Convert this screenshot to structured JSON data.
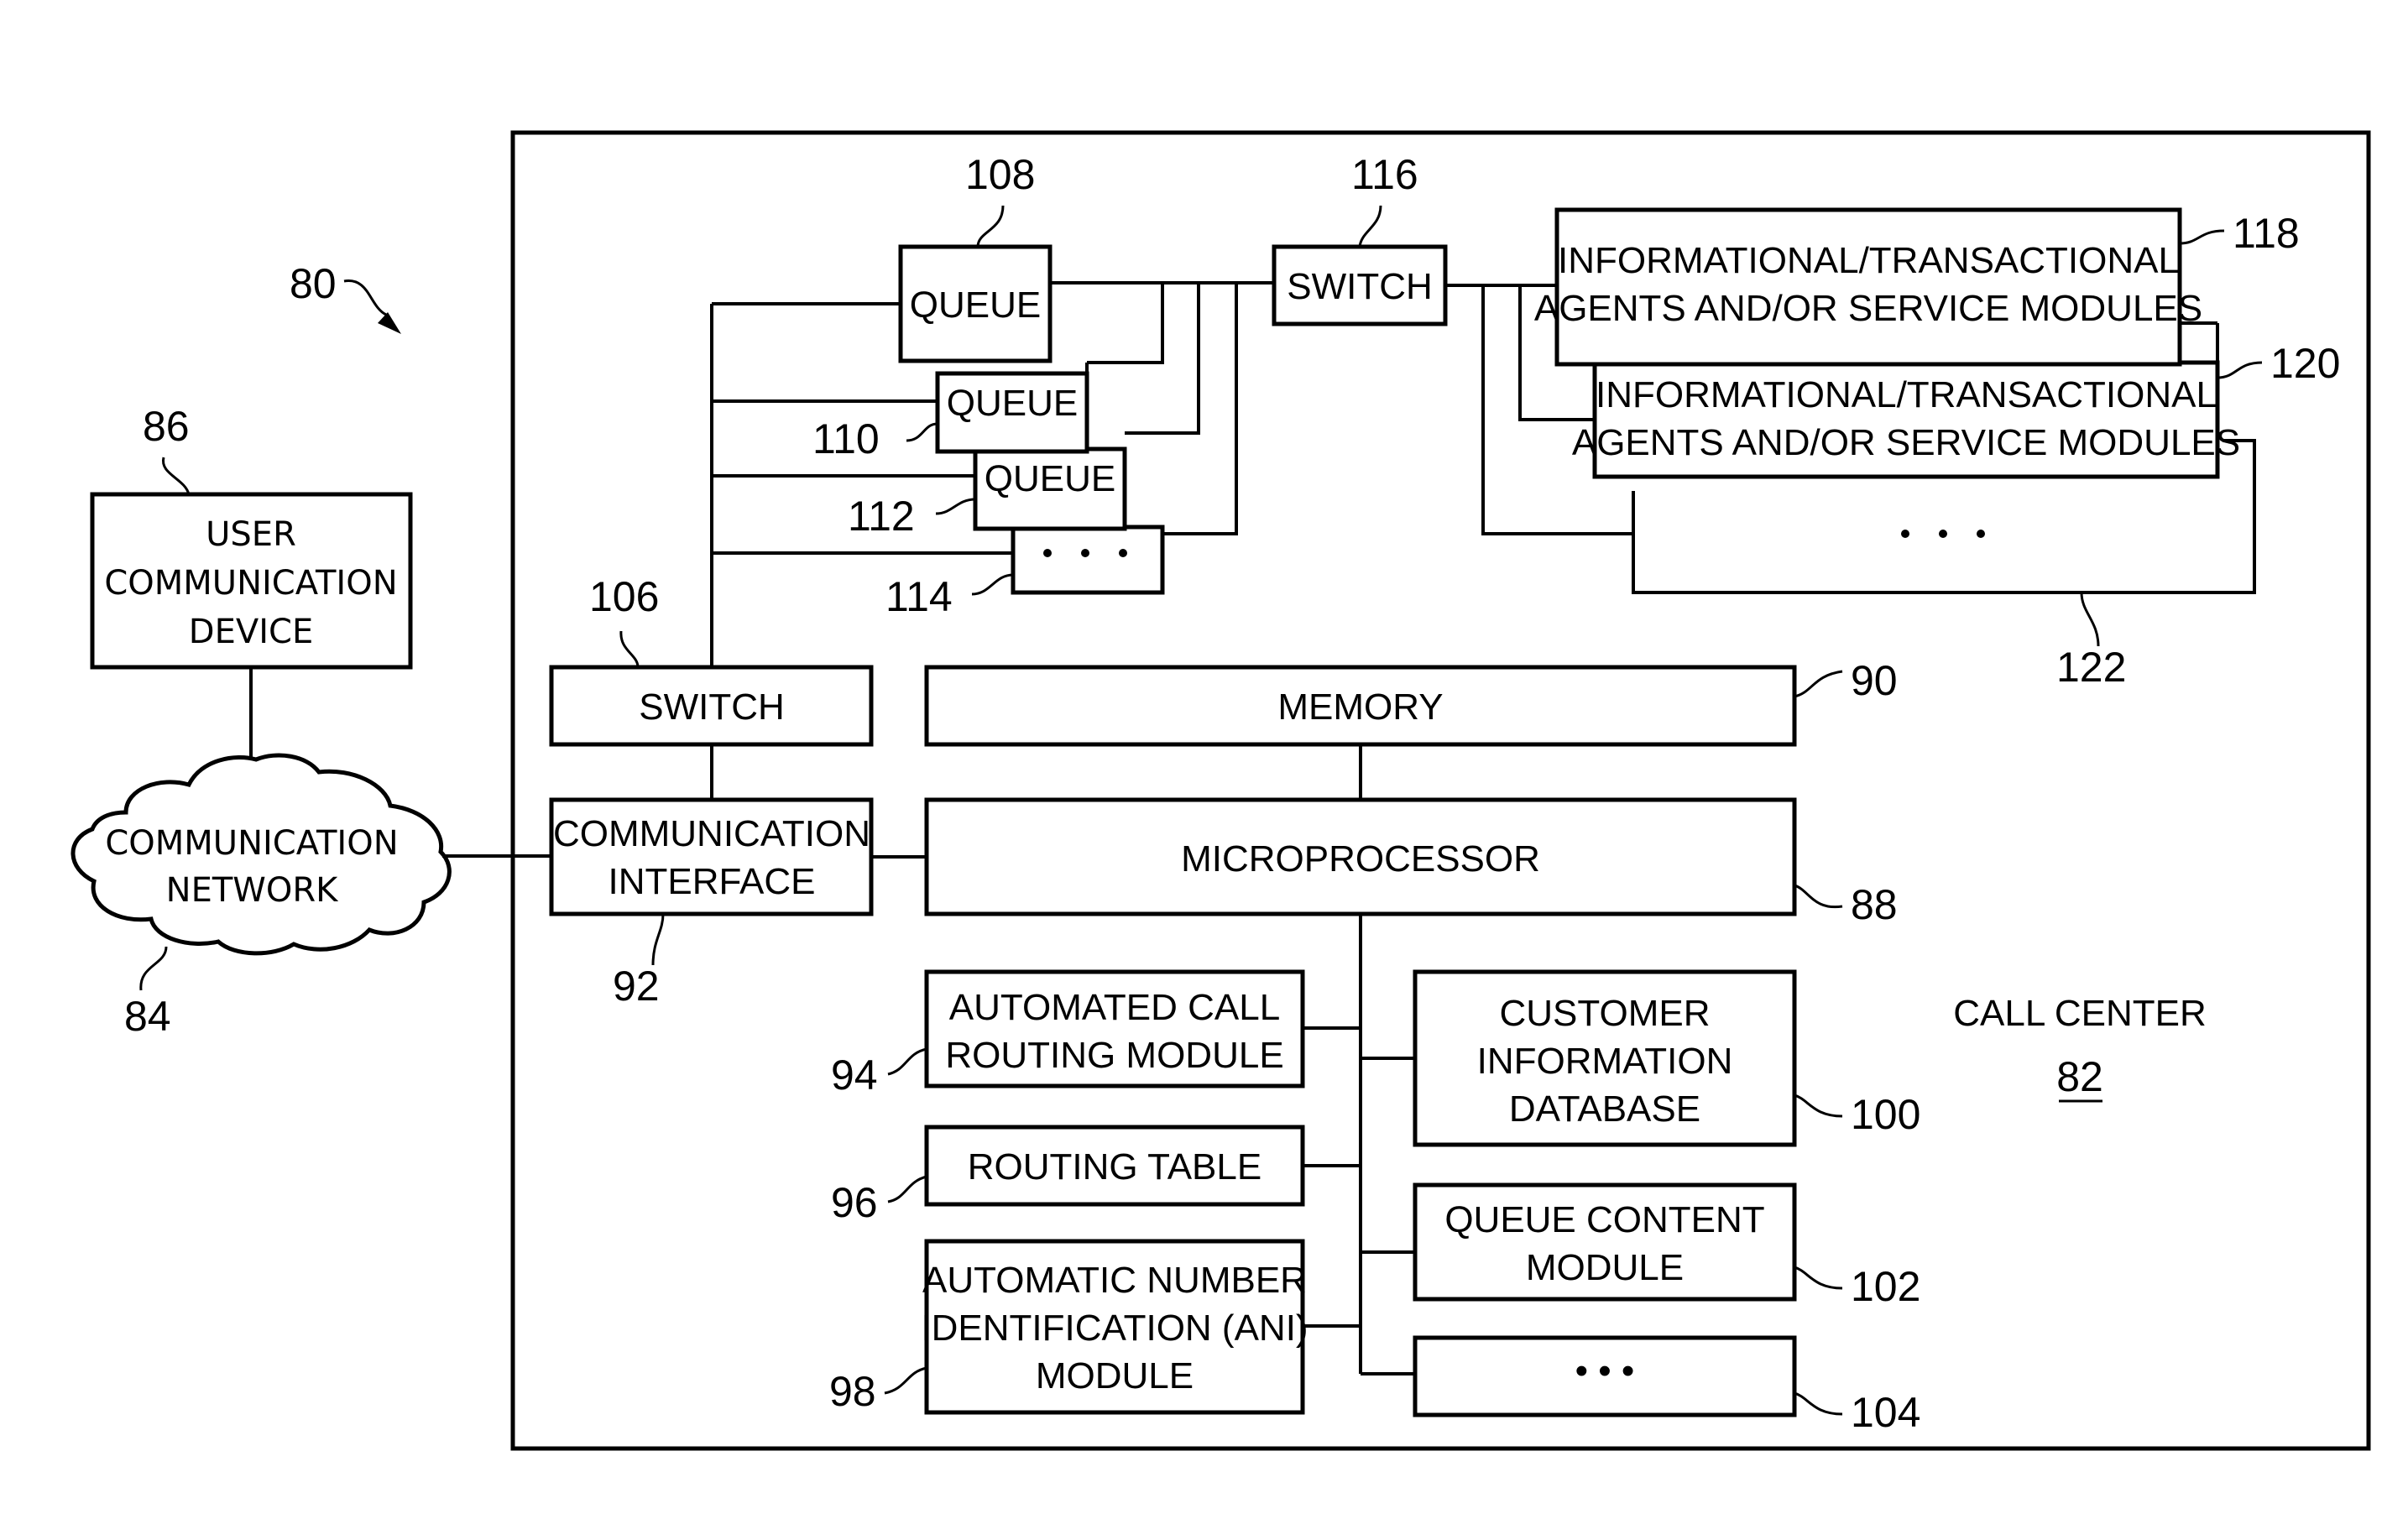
{
  "figure": {
    "figure_ref": "80",
    "call_center": {
      "label": "CALL CENTER",
      "ref": "82"
    }
  },
  "external": {
    "user_device": {
      "lines": [
        "USER",
        "COMMUNICATION",
        "DEVICE"
      ],
      "ref": "86"
    },
    "network": {
      "lines": [
        "COMMUNICATION",
        "NETWORK"
      ],
      "ref": "84"
    }
  },
  "blocks": {
    "switch_in": {
      "label": "SWITCH",
      "ref": "106"
    },
    "comm_interface": {
      "lines": [
        "COMMUNICATION",
        "INTERFACE"
      ],
      "ref": "92"
    },
    "memory": {
      "label": "MEMORY",
      "ref": "90"
    },
    "microprocessor": {
      "label": "MICROPROCESSOR",
      "ref": "88"
    },
    "auto_call_routing": {
      "lines": [
        "AUTOMATED CALL",
        "ROUTING MODULE"
      ],
      "ref": "94"
    },
    "routing_table": {
      "label": "ROUTING TABLE",
      "ref": "96"
    },
    "ani_module": {
      "lines": [
        "AUTOMATIC NUMBER",
        "IDENTIFICATION (ANI)",
        "MODULE"
      ],
      "ref": "98"
    },
    "customer_db": {
      "lines": [
        "CUSTOMER",
        "INFORMATION",
        "DATABASE"
      ],
      "ref": "100"
    },
    "queue_content": {
      "lines": [
        "QUEUE CONTENT",
        "MODULE"
      ],
      "ref": "102"
    },
    "more_modules": {
      "label": "• • •",
      "ref": "104"
    }
  },
  "queues": [
    {
      "label": "QUEUE",
      "ref": "108"
    },
    {
      "label": "QUEUE",
      "ref": "110"
    },
    {
      "label": "QUEUE",
      "ref": "112"
    },
    {
      "label": "• • •",
      "ref": "114"
    }
  ],
  "switch_out": {
    "label": "SWITCH",
    "ref": "116"
  },
  "agents": [
    {
      "lines": [
        "INFORMATIONAL/TRANSACTIONAL",
        "AGENTS AND/OR SERVICE MODULES"
      ],
      "ref": "118"
    },
    {
      "lines": [
        "INFORMATIONAL/TRANSACTIONAL",
        "AGENTS AND/OR SERVICE MODULES"
      ],
      "ref": "120"
    },
    {
      "label": "• • •",
      "ref": "122"
    }
  ]
}
